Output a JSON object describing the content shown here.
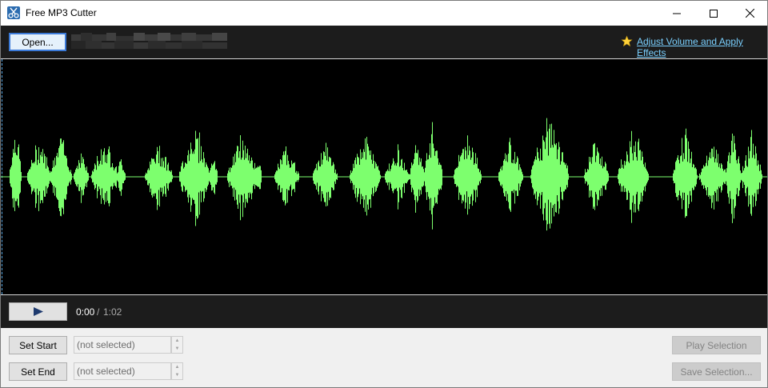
{
  "window": {
    "title": "Free MP3 Cutter"
  },
  "toolbar": {
    "open_label": "Open...",
    "effects_link": "Adjust Volume and Apply Effects"
  },
  "player": {
    "current_time": "0:00",
    "separator": "/",
    "total_time": "1:02"
  },
  "selection": {
    "set_start_label": "Set Start",
    "set_end_label": "Set End",
    "start_value": "(not selected)",
    "end_value": "(not selected)",
    "play_selection_label": "Play Selection",
    "save_selection_label": "Save Selection..."
  },
  "colors": {
    "waveform": "#7dff6e",
    "background": "#000000",
    "toolbar": "#1c1c1c",
    "link": "#7ad0ff"
  },
  "icons": {
    "app": "scissors-icon",
    "star": "star-icon",
    "play": "play-icon"
  }
}
